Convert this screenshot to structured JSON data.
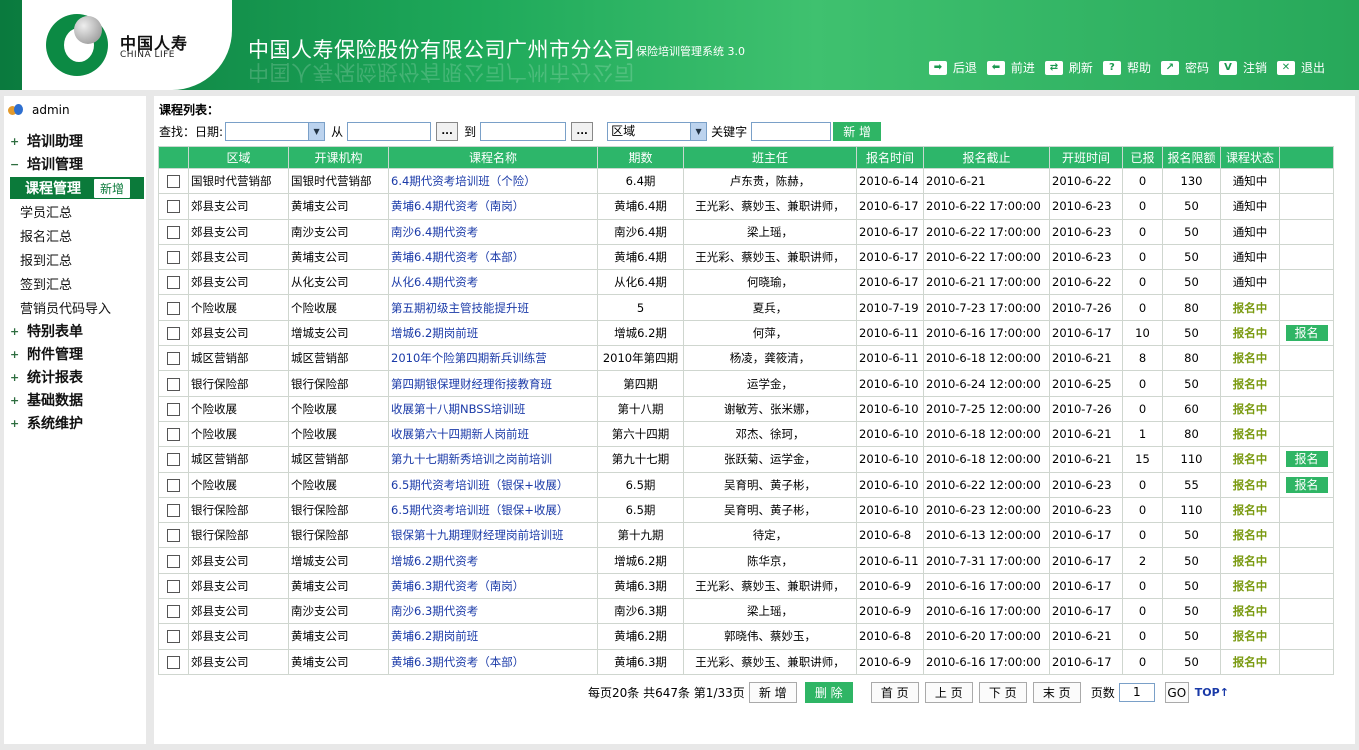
{
  "header": {
    "logo_cn": "中国人寿",
    "logo_en": "CHINA LIFE",
    "company": "中国人寿保险股份有限公司广州市分公司",
    "system": "保险培训管理系统 3.0",
    "tools": [
      {
        "label": "后退",
        "icon": "back-icon"
      },
      {
        "label": "前进",
        "icon": "forward-icon"
      },
      {
        "label": "刷新",
        "icon": "refresh-icon"
      },
      {
        "label": "帮助",
        "icon": "help-icon"
      },
      {
        "label": "密码",
        "icon": "password-icon"
      },
      {
        "label": "注销",
        "icon": "logout-icon"
      },
      {
        "label": "退出",
        "icon": "exit-icon"
      }
    ]
  },
  "sidebar": {
    "user": "admin",
    "groups": [
      "培训助理",
      "培训管理",
      "特别表单",
      "附件管理",
      "统计报表",
      "基础数据",
      "系统维护"
    ],
    "active_item": "课程管理",
    "active_add": "新增",
    "subitems": [
      "学员汇总",
      "报名汇总",
      "报到汇总",
      "签到汇总",
      "营销员代码导入"
    ]
  },
  "main": {
    "title": "课程列表：",
    "filter": {
      "find_label": "查找：",
      "date_label": "日期:",
      "from_label": "从",
      "to_label": "到",
      "dots": "...",
      "region_value": "区域",
      "keyword_label": "关键字",
      "add_button": "新 增"
    },
    "columns": [
      "",
      "区域",
      "开课机构",
      "课程名称",
      "期数",
      "班主任",
      "报名时间",
      "报名截止",
      "开班时间",
      "已报",
      "报名限额",
      "课程状态",
      ""
    ],
    "rows": [
      [
        "国银时代营销部",
        "国银时代营销部",
        "6.4期代资考培训班（个险）",
        "6.4期",
        "卢东贵，陈赫，",
        "2010-6-14",
        "2010-6-21",
        "2010-6-22",
        "0",
        "130",
        "通知中",
        ""
      ],
      [
        "郊县支公司",
        "黄埔支公司",
        "黄埔6.4期代资考（南岗）",
        "黄埔6.4期",
        "王光彩、蔡妙玉、兼职讲师，",
        "2010-6-17",
        "2010-6-22 17:00:00",
        "2010-6-23",
        "0",
        "50",
        "通知中",
        ""
      ],
      [
        "郊县支公司",
        "南沙支公司",
        "南沙6.4期代资考",
        "南沙6.4期",
        "梁上瑶，",
        "2010-6-17",
        "2010-6-22 17:00:00",
        "2010-6-23",
        "0",
        "50",
        "通知中",
        ""
      ],
      [
        "郊县支公司",
        "黄埔支公司",
        "黄埔6.4期代资考（本部）",
        "黄埔6.4期",
        "王光彩、蔡妙玉、兼职讲师，",
        "2010-6-17",
        "2010-6-22 17:00:00",
        "2010-6-23",
        "0",
        "50",
        "通知中",
        ""
      ],
      [
        "郊县支公司",
        "从化支公司",
        "从化6.4期代资考",
        "从化6.4期",
        "何晓瑜，",
        "2010-6-17",
        "2010-6-21 17:00:00",
        "2010-6-22",
        "0",
        "50",
        "通知中",
        ""
      ],
      [
        "个险收展",
        "个险收展",
        "第五期初级主管技能提升班",
        "5",
        "夏兵，",
        "2010-7-19",
        "2010-7-23 17:00:00",
        "2010-7-26",
        "0",
        "80",
        "报名中",
        ""
      ],
      [
        "郊县支公司",
        "增城支公司",
        "增城6.2期岗前班",
        "增城6.2期",
        "何萍，",
        "2010-6-11",
        "2010-6-16 17:00:00",
        "2010-6-17",
        "10",
        "50",
        "报名中",
        "报名"
      ],
      [
        "城区营销部",
        "城区营销部",
        "2010年个险第四期新兵训练营",
        "2010年第四期",
        "杨凌，龚筱清，",
        "2010-6-11",
        "2010-6-18 12:00:00",
        "2010-6-21",
        "8",
        "80",
        "报名中",
        ""
      ],
      [
        "银行保险部",
        "银行保险部",
        "第四期银保理财经理衔接教育班",
        "第四期",
        "运学金，",
        "2010-6-10",
        "2010-6-24 12:00:00",
        "2010-6-25",
        "0",
        "50",
        "报名中",
        ""
      ],
      [
        "个险收展",
        "个险收展",
        "收展第十八期NBSS培训班",
        "第十八期",
        "谢敏芳、张米娜，",
        "2010-6-10",
        "2010-7-25 12:00:00",
        "2010-7-26",
        "0",
        "60",
        "报名中",
        ""
      ],
      [
        "个险收展",
        "个险收展",
        "收展第六十四期新人岗前班",
        "第六十四期",
        "邓杰、徐珂，",
        "2010-6-10",
        "2010-6-18 12:00:00",
        "2010-6-21",
        "1",
        "80",
        "报名中",
        ""
      ],
      [
        "城区营销部",
        "城区营销部",
        "第九十七期新秀培训之岗前培训",
        "第九十七期",
        "张跃菊、运学金，",
        "2010-6-10",
        "2010-6-18 12:00:00",
        "2010-6-21",
        "15",
        "110",
        "报名中",
        "报名"
      ],
      [
        "个险收展",
        "个险收展",
        "6.5期代资考培训班（银保+收展）",
        "6.5期",
        "吴育明、黄子彬，",
        "2010-6-10",
        "2010-6-22 12:00:00",
        "2010-6-23",
        "0",
        "55",
        "报名中",
        "报名"
      ],
      [
        "银行保险部",
        "银行保险部",
        "6.5期代资考培训班（银保+收展）",
        "6.5期",
        "吴育明、黄子彬，",
        "2010-6-10",
        "2010-6-23 12:00:00",
        "2010-6-23",
        "0",
        "110",
        "报名中",
        ""
      ],
      [
        "银行保险部",
        "银行保险部",
        "银保第十九期理财经理岗前培训班",
        "第十九期",
        "待定，",
        "2010-6-8",
        "2010-6-13 12:00:00",
        "2010-6-17",
        "0",
        "50",
        "报名中",
        ""
      ],
      [
        "郊县支公司",
        "增城支公司",
        "增城6.2期代资考",
        "增城6.2期",
        "陈华京，",
        "2010-6-11",
        "2010-7-31 17:00:00",
        "2010-6-17",
        "2",
        "50",
        "报名中",
        ""
      ],
      [
        "郊县支公司",
        "黄埔支公司",
        "黄埔6.3期代资考（南岗）",
        "黄埔6.3期",
        "王光彩、蔡妙玉、兼职讲师，",
        "2010-6-9",
        "2010-6-16 17:00:00",
        "2010-6-17",
        "0",
        "50",
        "报名中",
        ""
      ],
      [
        "郊县支公司",
        "南沙支公司",
        "南沙6.3期代资考",
        "南沙6.3期",
        "梁上瑶，",
        "2010-6-9",
        "2010-6-16 17:00:00",
        "2010-6-17",
        "0",
        "50",
        "报名中",
        ""
      ],
      [
        "郊县支公司",
        "黄埔支公司",
        "黄埔6.2期岗前班",
        "黄埔6.2期",
        "郭晓伟、蔡妙玉，",
        "2010-6-8",
        "2010-6-20 17:00:00",
        "2010-6-21",
        "0",
        "50",
        "报名中",
        ""
      ],
      [
        "郊县支公司",
        "黄埔支公司",
        "黄埔6.3期代资考（本部）",
        "黄埔6.3期",
        "王光彩、蔡妙玉、兼职讲师，",
        "2010-6-9",
        "2010-6-16 17:00:00",
        "2010-6-17",
        "0",
        "50",
        "报名中",
        ""
      ]
    ],
    "pager": {
      "summary": "每页20条 共647条 第1/33页",
      "add": "新 增",
      "delete": "删 除",
      "first": "首 页",
      "prev": "上 页",
      "next": "下 页",
      "last": "末 页",
      "pages_label": "页数",
      "page_value": "1",
      "go": "GO",
      "top": "TOP↑"
    }
  },
  "colors": {
    "brand_green": "#0b7a3a",
    "header_green": "#2db66a",
    "link": "#1a3aa8",
    "status_open": "#7a9a10"
  }
}
